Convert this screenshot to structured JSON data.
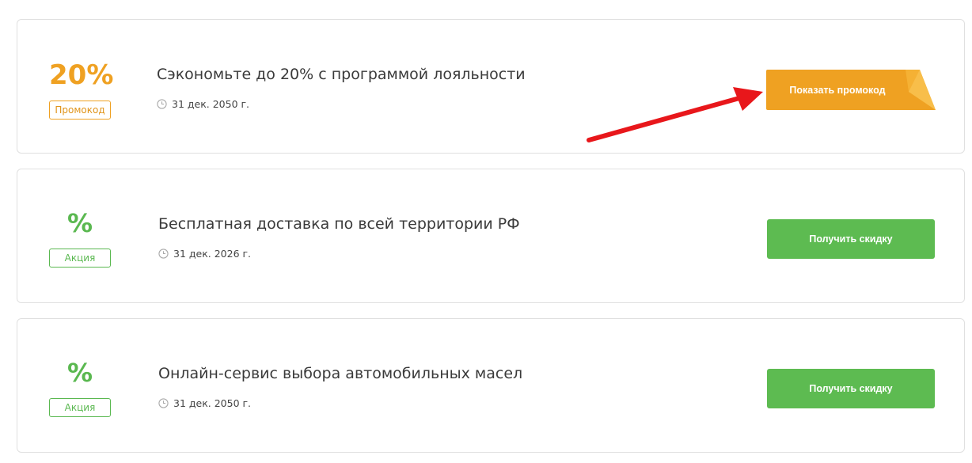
{
  "offers": [
    {
      "value": "20%",
      "tag": "Промокод",
      "title": "Сэкономьте до 20% с программой лояльности",
      "date": "31 дек. 2050 г.",
      "button": "Показать промокод",
      "accent": "#efa122"
    },
    {
      "value": "%",
      "tag": "Акция",
      "title": "Бесплатная доставка по всей территории РФ",
      "date": "31 дек. 2026 г.",
      "button": "Получить скидку",
      "accent": "#5dbb51"
    },
    {
      "value": "%",
      "tag": "Акция",
      "title": "Онлайн-сервис выбора автомобильных масел",
      "date": "31 дек. 2050 г.",
      "button": "Получить скидку",
      "accent": "#5dbb51"
    }
  ],
  "annotation": {
    "arrow_color": "#e8171b"
  }
}
